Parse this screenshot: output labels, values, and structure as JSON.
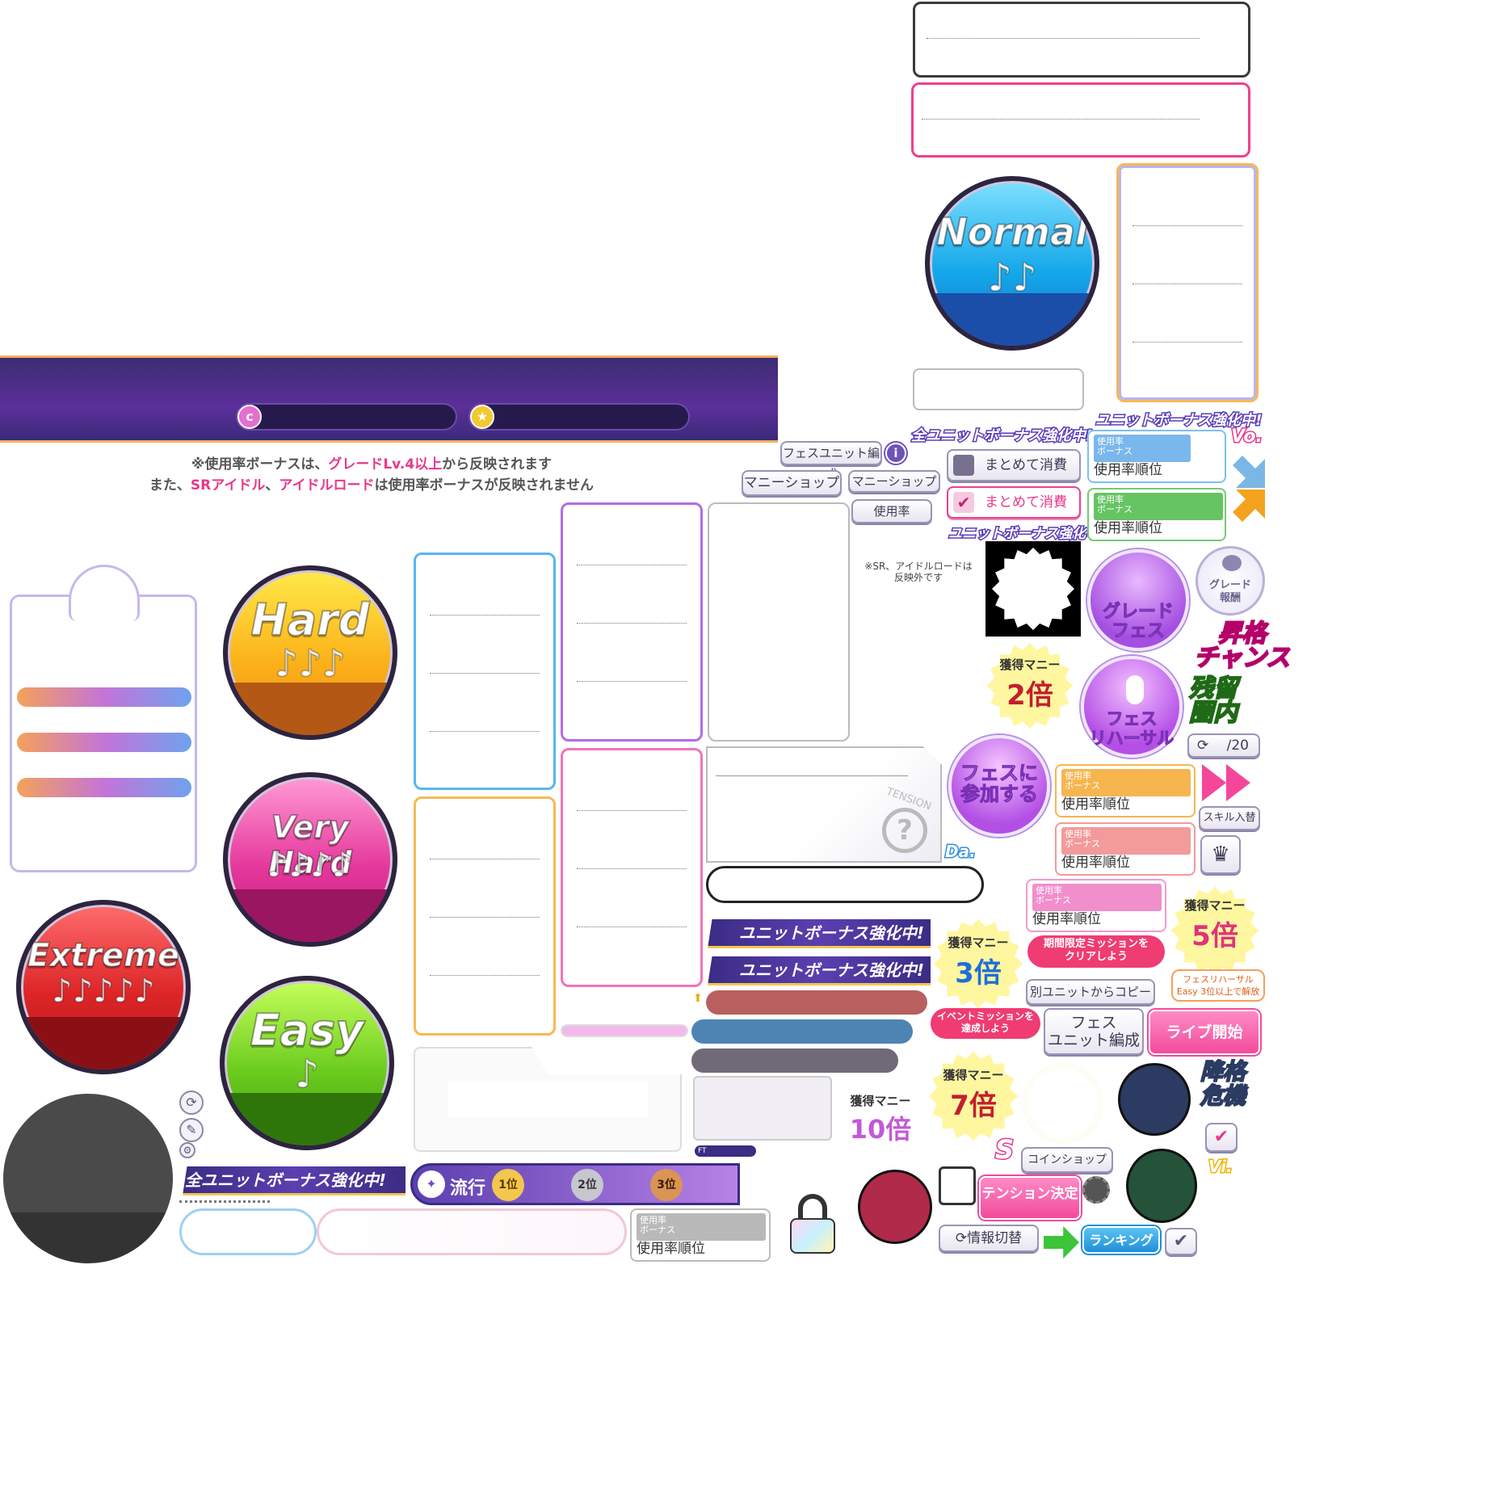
{
  "difficulty": {
    "normal": {
      "label": "Normal",
      "notes": "♪♪"
    },
    "hard": {
      "label": "Hard",
      "notes": "♪♪♪"
    },
    "very_hard": {
      "label": "Very Hard",
      "notes": "♪♪♪♪"
    },
    "extreme": {
      "label": "Extreme",
      "notes": "♪♪♪♪♪"
    },
    "easy": {
      "label": "Easy",
      "notes": "♪"
    }
  },
  "notice": {
    "line1_a": "※使用率ボーナスは、",
    "line1_b": "グレードLv.4以上",
    "line1_c": "から反映されます",
    "line2_a": "また、",
    "line2_b": "SRアイドル",
    "line2_c": "、",
    "line2_d": "アイドルロード",
    "line2_e": "は使用率ボーナスが反映されません"
  },
  "buttons": {
    "fes_unit_edit": "フェスユニット編成",
    "info": "i",
    "money_shop_1": "マニーショップ",
    "money_shop_2": "マニーショップ",
    "usage_rate": "使用率",
    "bulk_consume_off": "まとめて消費",
    "bulk_consume_on": "まとめて消費",
    "skill_entry": "スキル入替",
    "copy_from_other": "別ユニットからコピー",
    "fes_unit_edit_2_a": "フェス",
    "fes_unit_edit_2_b": "ユニット編成",
    "live_start": "ライブ開始",
    "coin_shop": "コインショップ",
    "tension_decide": "テンション決定",
    "info_switch": "情報切替",
    "ranking": "ランキング",
    "page_counter": "/20"
  },
  "banners": {
    "all_unit_bonus_1": "全ユニットボーナス強化中!",
    "unit_bonus_top": "ユニットボーナス強化中!",
    "unit_bonus_mid": "ユニットボーナス強化中!",
    "unit_bonus_ribbon_1": "ユニットボーナス強化中!",
    "unit_bonus_ribbon_2": "ユニットボーナス強化中!",
    "all_unit_bonus_bottom": "全ユニットボーナス強化中!",
    "trend": "流行",
    "rank1": "1位",
    "rank2": "2位",
    "rank3": "3位"
  },
  "usage_cards": {
    "bar_label": "使用率\nボーナス",
    "rank_label": "使用率順位"
  },
  "note_sr": {
    "line1": "※SR、アイドルロードは",
    "line2": "反映外です"
  },
  "circles": {
    "grade_fes_a": "グレード",
    "grade_fes_b": "フェス",
    "fes_rehearsal_a": "フェス",
    "fes_rehearsal_b": "リハーサル",
    "join_fes_a": "フェスに",
    "join_fes_b": "参加する",
    "grade_reward_a": "グレード",
    "grade_reward_b": "報酬"
  },
  "stamps": {
    "money_label": "獲得マニー",
    "x2": "2倍",
    "x3": "3倍",
    "x5": "5倍",
    "x7": "7倍",
    "x10": "10倍"
  },
  "headings": {
    "promotion_chance_a": "昇格",
    "promotion_chance_b": "チャンス",
    "stay_zone_a": "残留",
    "stay_zone_b": "圏内",
    "demotion_risk_a": "降格",
    "demotion_risk_b": "危機"
  },
  "tags": {
    "limited_mission_a": "期間限定ミッションを",
    "limited_mission_b": "クリアしよう",
    "event_mission_a": "イベントミッションを",
    "event_mission_b": "達成しよう",
    "rehearsal_note_a": "フェスリハーサル",
    "rehearsal_note_b": "Easy 3位以上で解放",
    "tension": "TENSION",
    "vo": "Vo.",
    "da": "Da.",
    "vi": "Vi.",
    "s_rank": "S",
    "ft": "FT"
  },
  "colors": {
    "normal": "#1aa8e8",
    "hard": "#f2a016",
    "very_hard": "#e0338f",
    "extreme": "#d3232a",
    "easy": "#5ec51e",
    "accent_pink": "#e8388a"
  }
}
